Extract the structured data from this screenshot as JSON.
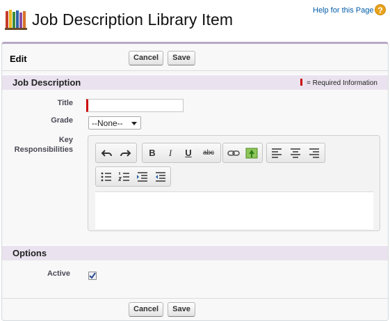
{
  "header": {
    "title": "Job Description Library Item",
    "help_text": "Help for this Page",
    "help_icon": "?"
  },
  "edit_block": {
    "label": "Edit",
    "cancel_label": "Cancel",
    "save_label": "Save"
  },
  "job_description_section": {
    "title": "Job Description",
    "required_legend": "= Required Information",
    "fields": {
      "title_label": "Title",
      "title_value": "",
      "grade_label": "Grade",
      "grade_value": "--None--",
      "key_responsibilities_label": "Key Responsibilities"
    }
  },
  "editor_toolbar": {
    "icons": [
      "undo-icon",
      "redo-icon",
      "bold-icon",
      "italic-icon",
      "underline-icon",
      "strikethrough-icon",
      "link-icon",
      "image-icon",
      "align-left-icon",
      "align-center-icon",
      "align-right-icon",
      "bullet-list-icon",
      "numbered-list-icon",
      "indent-icon",
      "outdent-icon"
    ],
    "bold": "B",
    "italic": "I",
    "underline": "U",
    "strike": "abc"
  },
  "options_section": {
    "title": "Options",
    "active_label": "Active",
    "active_checked": true
  },
  "colors": {
    "accent": "#b7a7c5",
    "section_bg": "#eae3ef",
    "required": "#cc0000",
    "link": "#015ba7"
  }
}
